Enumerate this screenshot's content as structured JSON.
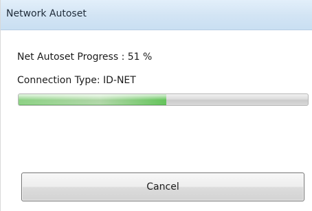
{
  "window": {
    "title": "Network Autoset"
  },
  "status": {
    "progress_text": "Net Autoset Progress : 51 %",
    "connection_text": "Connection Type: ID-NET"
  },
  "progress": {
    "fraction": 0.51
  },
  "actions": {
    "cancel_label": "Cancel"
  },
  "colors": {
    "title_bar": "#d2e4f4",
    "progress_fill": "#7fd174"
  }
}
